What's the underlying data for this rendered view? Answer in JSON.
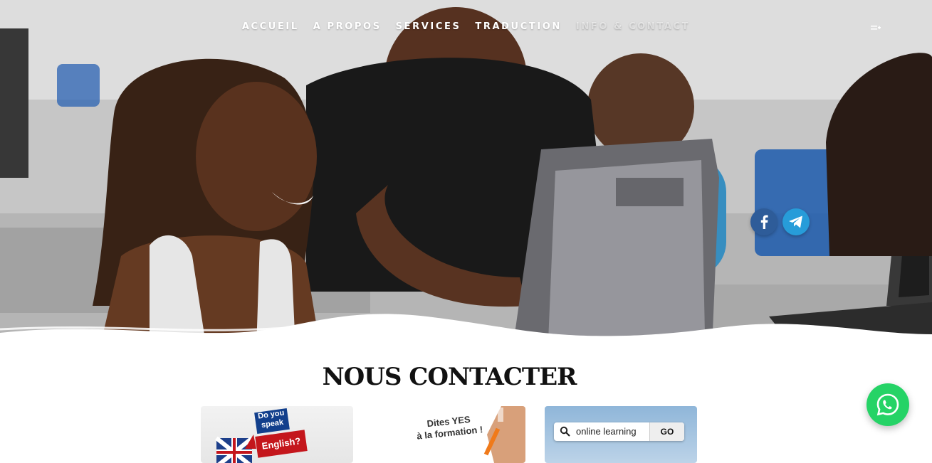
{
  "nav": {
    "items": [
      "ACCUEIL",
      "A PROPOS",
      "SERVICES",
      "TRADUCTION",
      "INFO & CONTACT"
    ],
    "extra_icon": "menu-toggle-icon"
  },
  "social": {
    "facebook_icon": "facebook-icon",
    "telegram_icon": "telegram-icon",
    "facebook_color": "#2e5c99",
    "telegram_color": "#279cd9"
  },
  "section": {
    "title": "NOUS CONTACTER"
  },
  "cards": [
    {
      "badge_top": "Do you\nspeak",
      "badge_bottom": "English?"
    },
    {
      "text": "Dites YES\nà la formation !"
    },
    {
      "search_text": "online learning",
      "button": "GO"
    }
  ],
  "whatsapp": {
    "icon": "whatsapp-icon",
    "color": "#25d366"
  }
}
